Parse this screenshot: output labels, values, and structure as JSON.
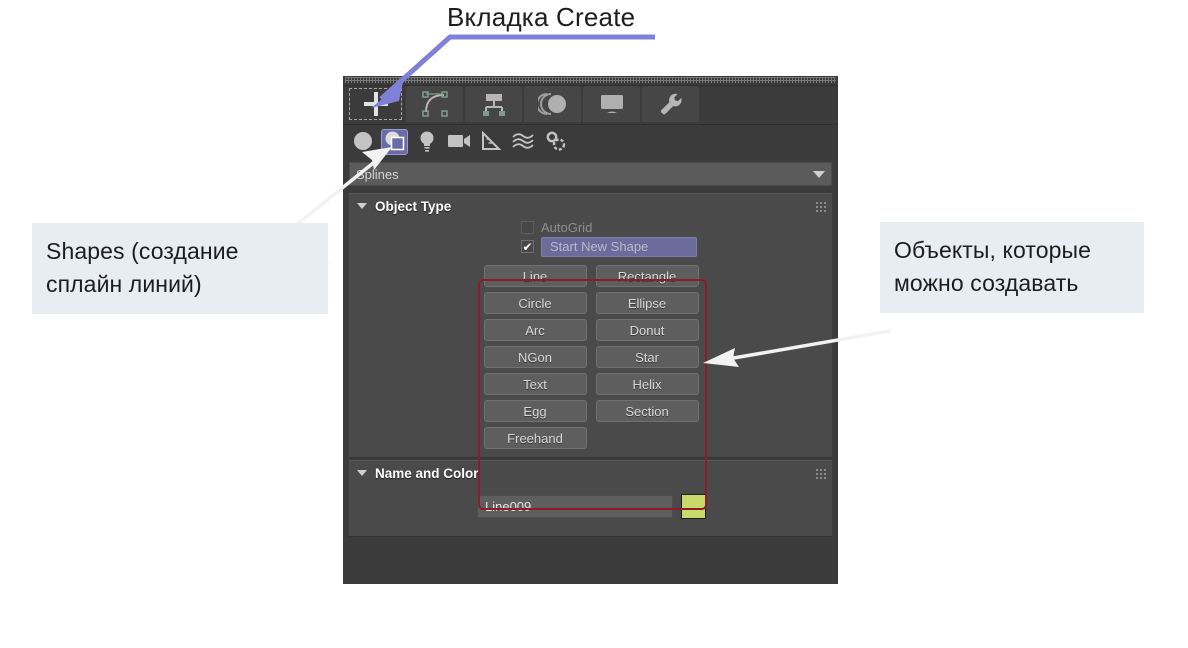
{
  "annotations": {
    "title": "Вкладка Create",
    "left_callout": "Shapes (создание\nсплайн линий)",
    "right_callout": "Объекты, которые\nможно создавать",
    "arrow_blue_color": "#8080d8",
    "arrow_white_color": "#f2f2f2",
    "callout_bg": "#e8edf4",
    "highlight_box_color": "#8f1b2a"
  },
  "panel": {
    "tabs": [
      {
        "name": "create",
        "icon": "plus-icon",
        "active": true
      },
      {
        "name": "modify",
        "icon": "curve-editor-icon",
        "active": false
      },
      {
        "name": "hierarchy",
        "icon": "hierarchy-icon",
        "active": false
      },
      {
        "name": "motion",
        "icon": "motion-icon",
        "active": false
      },
      {
        "name": "display",
        "icon": "display-monitor-icon",
        "active": false
      },
      {
        "name": "utilities",
        "icon": "wrench-icon",
        "active": false
      }
    ],
    "categories": [
      {
        "name": "geometry",
        "icon": "sphere-icon",
        "selected": false
      },
      {
        "name": "shapes",
        "icon": "shapes-overlap-icon",
        "selected": true
      },
      {
        "name": "lights",
        "icon": "lightbulb-icon",
        "selected": false
      },
      {
        "name": "cameras",
        "icon": "camera-icon",
        "selected": false
      },
      {
        "name": "helpers",
        "icon": "triangle-ruler-icon",
        "selected": false
      },
      {
        "name": "space-warps",
        "icon": "waves-icon",
        "selected": false
      },
      {
        "name": "systems",
        "icon": "gears-icon",
        "selected": false
      }
    ],
    "dropdown": {
      "value": "Splines",
      "arrow_icon": "chevron-down-icon"
    },
    "object_type": {
      "title": "Object Type",
      "collapse_icon": "triangle-down-icon",
      "grip_icon": "grip-dots-icon",
      "autogrid": {
        "label": "AutoGrid",
        "checked": false
      },
      "start_new_shape": {
        "label": "Start New Shape",
        "checked": true
      },
      "buttons": [
        [
          "Line",
          "Rectangle"
        ],
        [
          "Circle",
          "Ellipse"
        ],
        [
          "Arc",
          "Donut"
        ],
        [
          "NGon",
          "Star"
        ],
        [
          "Text",
          "Helix"
        ],
        [
          "Egg",
          "Section"
        ],
        [
          "Freehand",
          ""
        ]
      ]
    },
    "name_and_color": {
      "title": "Name and Color",
      "collapse_icon": "triangle-down-icon",
      "grip_icon": "grip-dots-icon",
      "name_value": "Line009",
      "color_value": "#c9d96a"
    }
  }
}
